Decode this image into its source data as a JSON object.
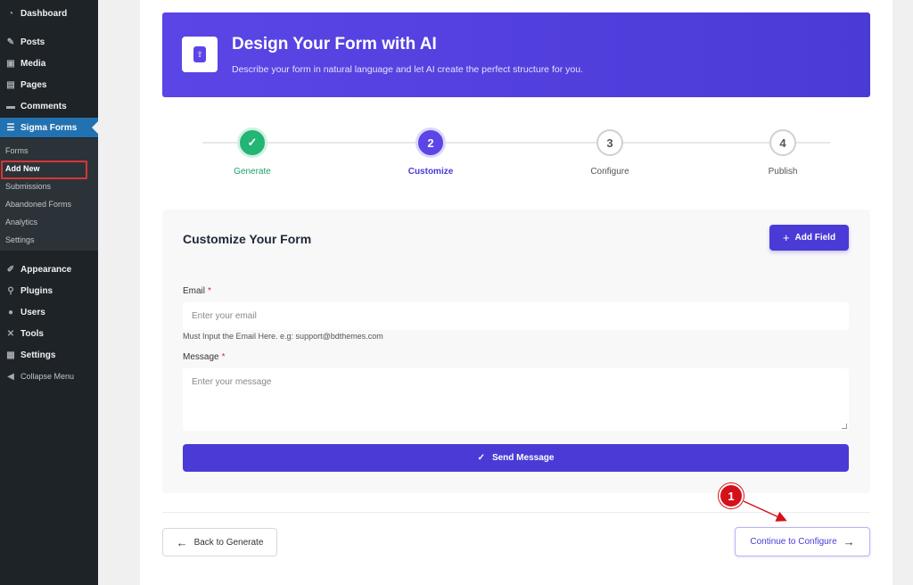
{
  "sidebar": {
    "dashboard": "Dashboard",
    "posts": "Posts",
    "media": "Media",
    "pages": "Pages",
    "comments": "Comments",
    "sigma_forms": "Sigma Forms",
    "submenu": [
      "Forms",
      "Add New",
      "Submissions",
      "Abandoned Forms",
      "Analytics",
      "Settings"
    ],
    "appearance": "Appearance",
    "plugins": "Plugins",
    "users": "Users",
    "tools": "Tools",
    "settings": "Settings",
    "collapse": "Collapse Menu"
  },
  "header": {
    "title": "Design Your Form with AI",
    "subtitle": "Describe your form in natural language and let AI create the perfect structure for you."
  },
  "steps": [
    {
      "number": "✓",
      "label": "Generate",
      "state": "done"
    },
    {
      "number": "2",
      "label": "Customize",
      "state": "active"
    },
    {
      "number": "3",
      "label": "Configure",
      "state": "pending"
    },
    {
      "number": "4",
      "label": "Publish",
      "state": "pending"
    }
  ],
  "form": {
    "title": "Customize Your Form",
    "add_field_label": "Add Field",
    "email_label": "Email",
    "email_required": "*",
    "email_placeholder": "Enter your email",
    "email_help": "Must Input the Email Here. e.g: support@bdthemes.com",
    "message_label": "Message",
    "message_required": "*",
    "message_placeholder": "Enter your message",
    "send_label": "Send Message"
  },
  "nav": {
    "back_label": "Back to Generate",
    "continue_label": "Continue to Configure"
  },
  "annotation": {
    "badge": "1"
  },
  "colors": {
    "accent": "#4a3bd6",
    "success": "#22b573",
    "annotation": "#d4111b",
    "wp_active": "#2271b1"
  }
}
